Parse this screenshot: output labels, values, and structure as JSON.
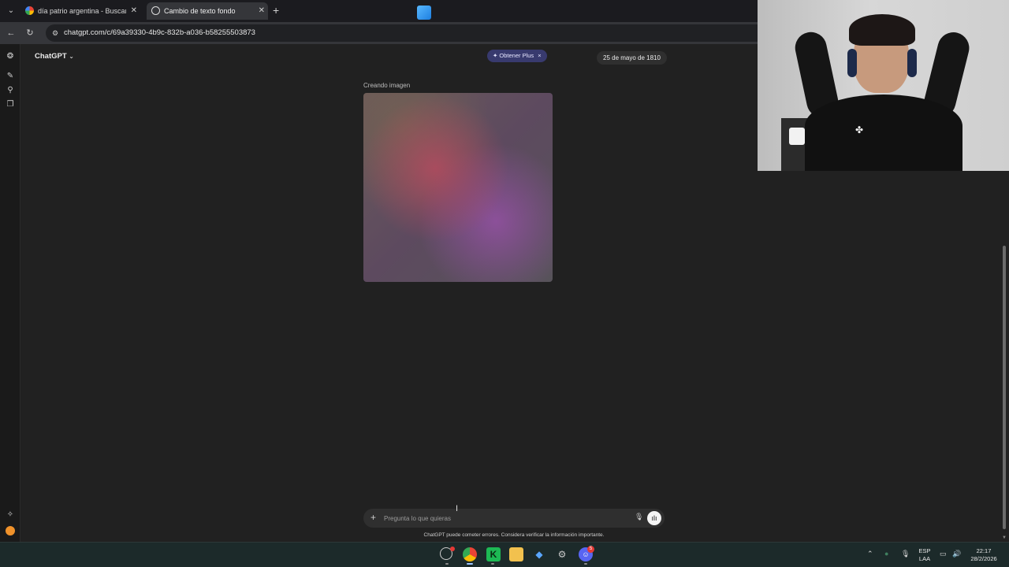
{
  "browser": {
    "tabs": [
      {
        "label": "día patrio argentina - Buscar co",
        "favicon": "google-g-icon",
        "active": false
      },
      {
        "label": "Cambio de texto fondo",
        "favicon": "chatgpt-icon",
        "active": true
      }
    ],
    "url": "chatgpt.com/c/69a39330-4b9c-832b-a036-b58255503873"
  },
  "header": {
    "model": "ChatGPT",
    "upgrade": "Obtener Plus",
    "date_badge": "25 de mayo de 1810"
  },
  "chat": {
    "status": "Creando imagen"
  },
  "composer": {
    "placeholder": "Pregunta lo que quieras",
    "disclaimer": "ChatGPT puede cometer errores. Considera verificar la información importante."
  },
  "taskbar": {
    "lang_top": "ESP",
    "lang_bottom": "LAA",
    "time": "22:17",
    "date": "28/2/2026",
    "discord_badge": "5"
  },
  "colors": {
    "background": "#212121",
    "plus_pill": "#383a6e",
    "user_avatar": "#f0922b"
  }
}
